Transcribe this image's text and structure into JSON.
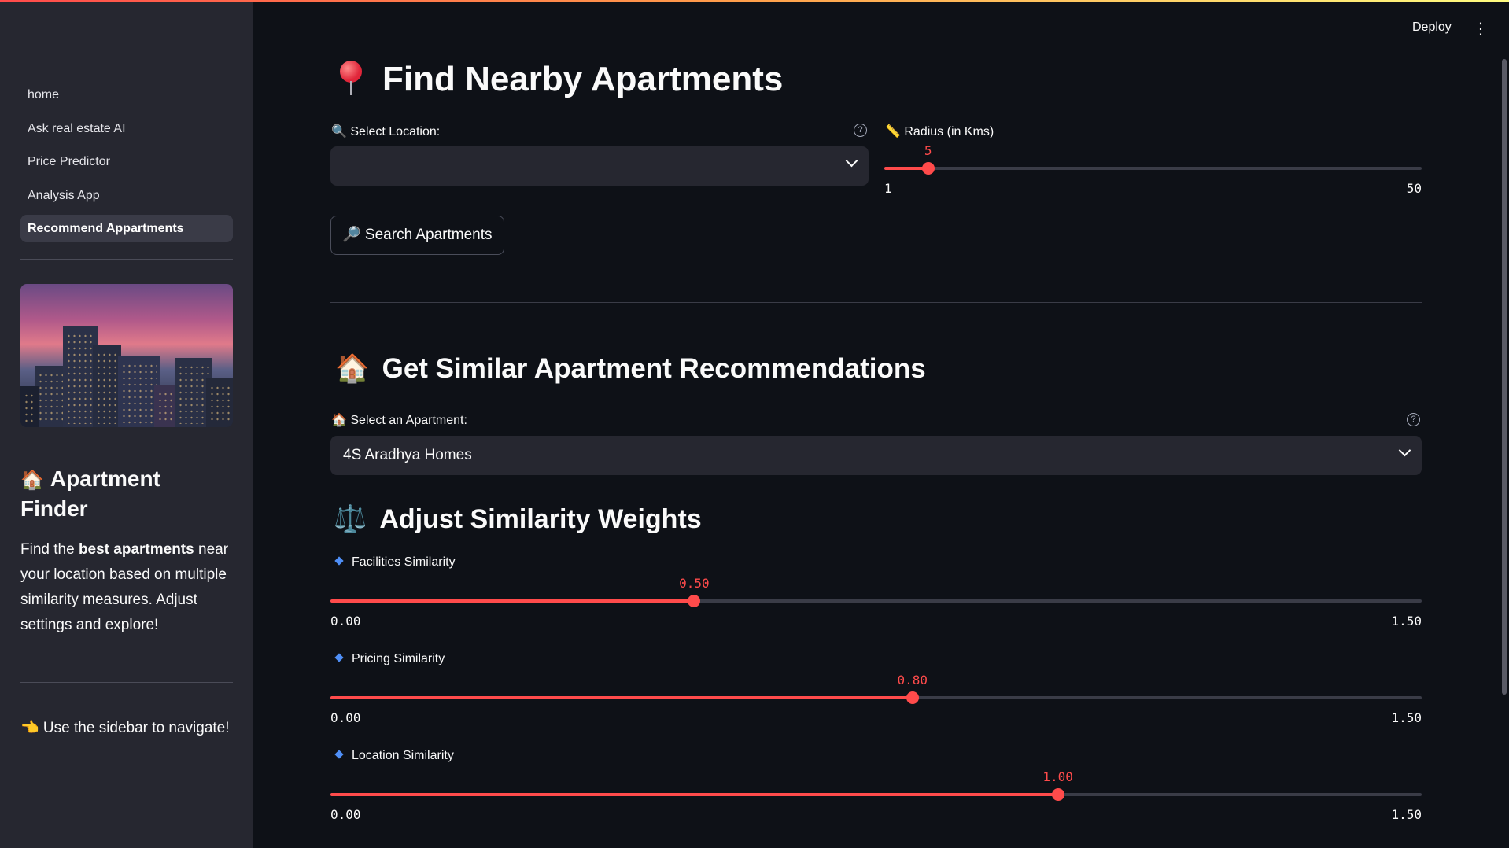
{
  "header": {
    "deploy_label": "Deploy",
    "menu_icon": "more-vertical-icon"
  },
  "sidebar": {
    "nav_items": [
      {
        "label": "home",
        "active": false
      },
      {
        "label": "Ask real estate AI",
        "active": false
      },
      {
        "label": "Price Predictor",
        "active": false
      },
      {
        "label": "Analysis App",
        "active": false
      },
      {
        "label": "Recommend Appartments",
        "active": true
      }
    ],
    "title_emoji": "🏠",
    "title": "Apartment Finder",
    "desc_pre": "Find the ",
    "desc_bold": "best apartments",
    "desc_post": " near your location based on multiple similarity measures. Adjust settings and explore!",
    "hint": "👈 Use the sidebar to navigate!"
  },
  "nearby": {
    "title": "Find Nearby Apartments",
    "location_label": "🔍 Select Location:",
    "location_value": "",
    "radius_label": "📏 Radius (in Kms)",
    "radius": {
      "value": 5,
      "min": 1,
      "max": 50,
      "value_label": "5",
      "min_label": "1",
      "max_label": "50"
    },
    "search_button": "🔎 Search Apartments"
  },
  "similar": {
    "title_emoji": "🏠",
    "title": "Get Similar Apartment Recommendations",
    "apartment_label": "🏠 Select an Apartment:",
    "apartment_value": "4S Aradhya Homes"
  },
  "weights": {
    "title_emoji": "⚖️",
    "title": "Adjust Similarity Weights",
    "sliders": [
      {
        "label": "Facilities Similarity",
        "value": 0.5,
        "min": 0,
        "max": 1.5,
        "value_label": "0.50",
        "min_label": "0.00",
        "max_label": "1.50"
      },
      {
        "label": "Pricing Similarity",
        "value": 0.8,
        "min": 0,
        "max": 1.5,
        "value_label": "0.80",
        "min_label": "0.00",
        "max_label": "1.50"
      },
      {
        "label": "Location Similarity",
        "value": 1.0,
        "min": 0,
        "max": 1.5,
        "value_label": "1.00",
        "min_label": "0.00",
        "max_label": "1.50"
      }
    ]
  },
  "colors": {
    "accent": "#ff4b4b",
    "background": "#0e1117",
    "sidebar": "#262730"
  }
}
